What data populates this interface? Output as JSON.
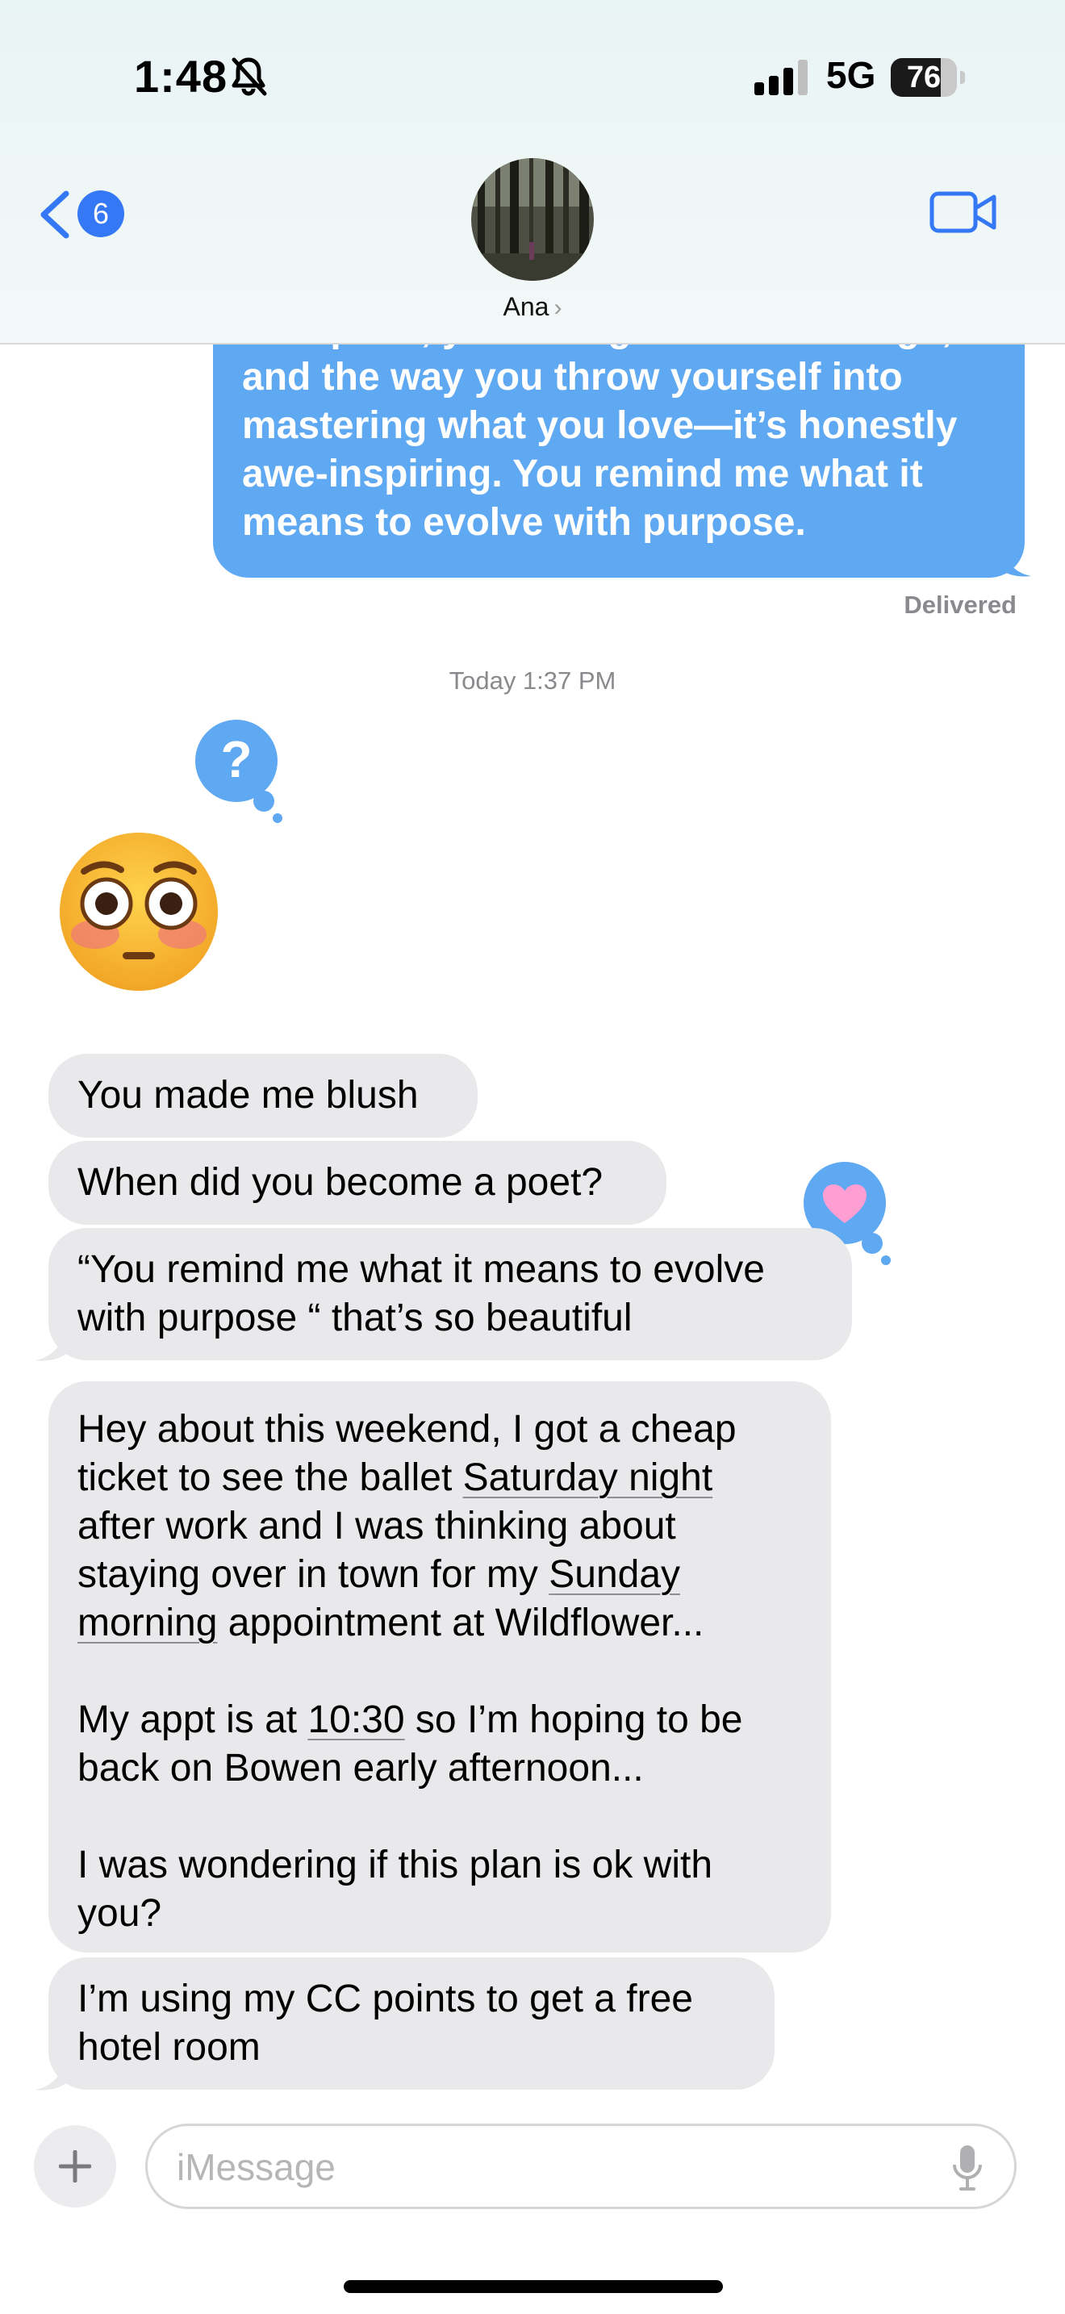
{
  "status_bar": {
    "time": "1:48",
    "network": "5G",
    "battery": "76",
    "battery_level": 0.76
  },
  "header": {
    "back_count": "6",
    "contact_name": "Ana",
    "name_chevron": "›"
  },
  "thread": {
    "sent_lines": [
      "discipline, your hunger for knowledge,",
      "and the way you throw yourself into",
      "mastering what you love—it’s honestly",
      "awe-inspiring. You remind me what it",
      "means to evolve with purpose."
    ],
    "delivered": "Delivered",
    "timestamp": "Today 1:37 PM",
    "tapback_question": "?",
    "emoji": "😳",
    "messages": [
      {
        "lines": [
          "You made me blush"
        ]
      },
      {
        "lines": [
          "When did you become a poet?"
        ]
      },
      {
        "lines": [
          "“You remind me what it means to evolve",
          "with purpose “ that’s so beautiful"
        ]
      },
      {
        "segments": [
          [
            "Hey about this weekend, I got a cheap"
          ],
          [
            "ticket to see the ballet ",
            "Saturday night"
          ],
          [
            "after work and I was thinking about"
          ],
          [
            "staying over in town for my ",
            "Sunday"
          ],
          [
            "morning",
            " appointment at Wildflower..."
          ],
          [
            ""
          ],
          [
            "My appt is at ",
            "10:30",
            " so I’m hoping to be"
          ],
          [
            "back on Bowen early afternoon..."
          ],
          [
            ""
          ],
          [
            "I was wondering if this plan is ok with"
          ],
          [
            "you?"
          ]
        ]
      },
      {
        "lines": [
          "I’m using my CC points to get a free",
          "hotel room"
        ]
      }
    ]
  },
  "composer": {
    "placeholder": "iMessage"
  },
  "icons": [
    "bell-slash-icon",
    "signal-icon",
    "chevron-left-icon",
    "video-camera-icon",
    "plus-icon",
    "microphone-icon",
    "heart-icon",
    "question-icon"
  ],
  "colors": {
    "sent_bubble": "#5fa8f2",
    "received_bubble": "#e9e9eb",
    "accent": "#3478f6"
  }
}
